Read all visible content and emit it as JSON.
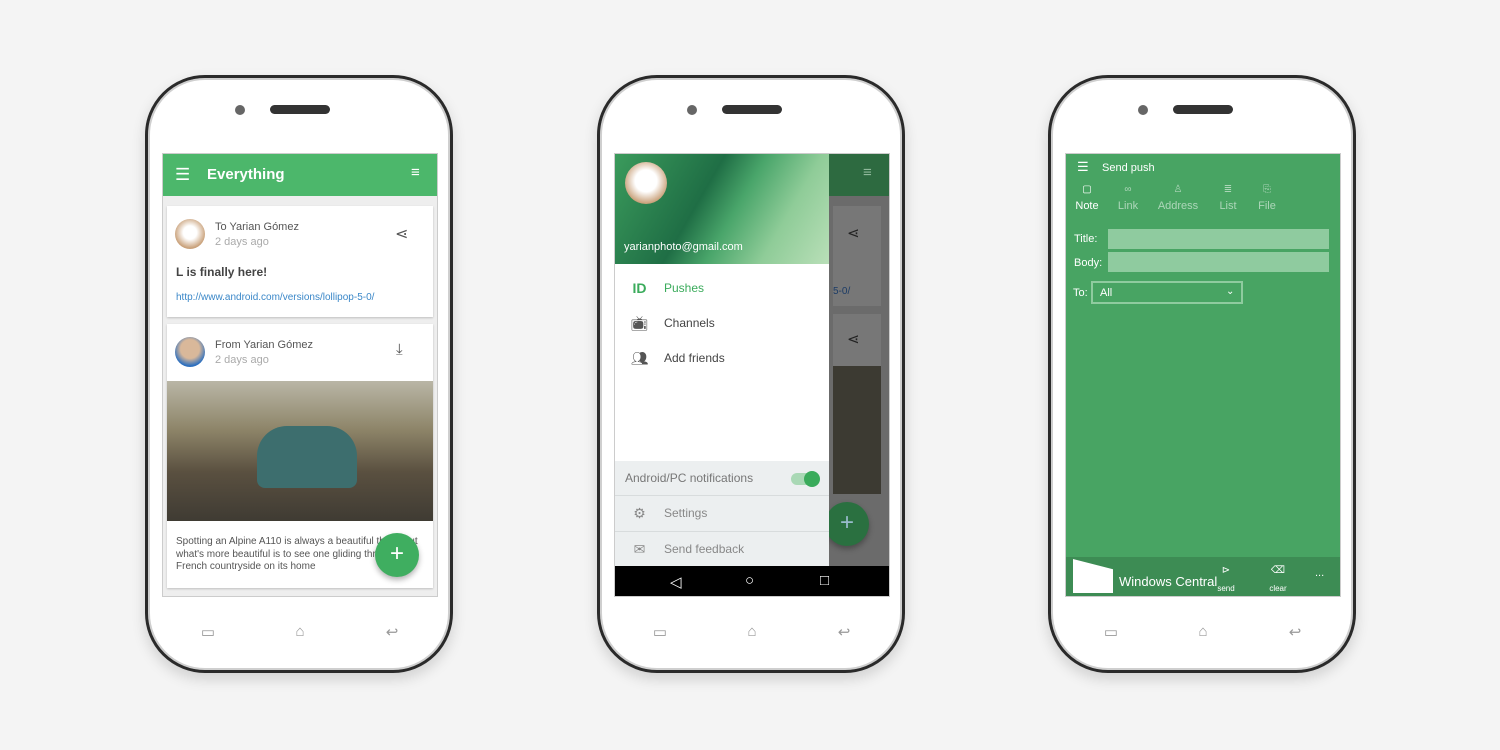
{
  "phone1": {
    "header": {
      "title": "Everything",
      "menu_icon": "hamburger-icon",
      "filter_icon": "filter-icon"
    },
    "cards": [
      {
        "name": "To Yarian Gómez",
        "time": "2 days ago",
        "title": "L is finally here!",
        "link": "http://www.android.com/versions/lollipop-5-0/",
        "action_icon": "share-icon"
      },
      {
        "name": "From Yarian Gómez",
        "time": "2 days ago",
        "body": "Spotting an Alpine A110 is always a beautiful thing, but what's more beautiful is to see one gliding through the French countryside on its home",
        "action_icon": "download-icon"
      }
    ],
    "fab": "+"
  },
  "phone2": {
    "email": "yarianphoto@gmail.com",
    "items": [
      {
        "label": "Pushes",
        "icon": "pushbullet-icon"
      },
      {
        "label": "Channels",
        "icon": "tv-icon"
      },
      {
        "label": "Add friends",
        "icon": "people-icon"
      }
    ],
    "notifications_label": "Android/PC notifications",
    "notifications_on": true,
    "footer": [
      {
        "label": "Settings",
        "icon": "gear-icon"
      },
      {
        "label": "Send feedback",
        "icon": "mail-icon"
      }
    ],
    "behind_link": "5-0/"
  },
  "phone3": {
    "title": "Send push",
    "tabs": [
      {
        "label": "Note",
        "active": true
      },
      {
        "label": "Link"
      },
      {
        "label": "Address"
      },
      {
        "label": "List"
      },
      {
        "label": "File"
      }
    ],
    "title_label": "Title:",
    "body_label": "Body:",
    "to_label": "To:",
    "to_value": "All",
    "appbar": {
      "send": "send",
      "clear": "clear",
      "more": "..."
    },
    "watermark": "Windows Central"
  },
  "colors": {
    "android_green": "#4cb76b",
    "wp_green": "#48a463",
    "wp_bar": "#3d8c54"
  }
}
